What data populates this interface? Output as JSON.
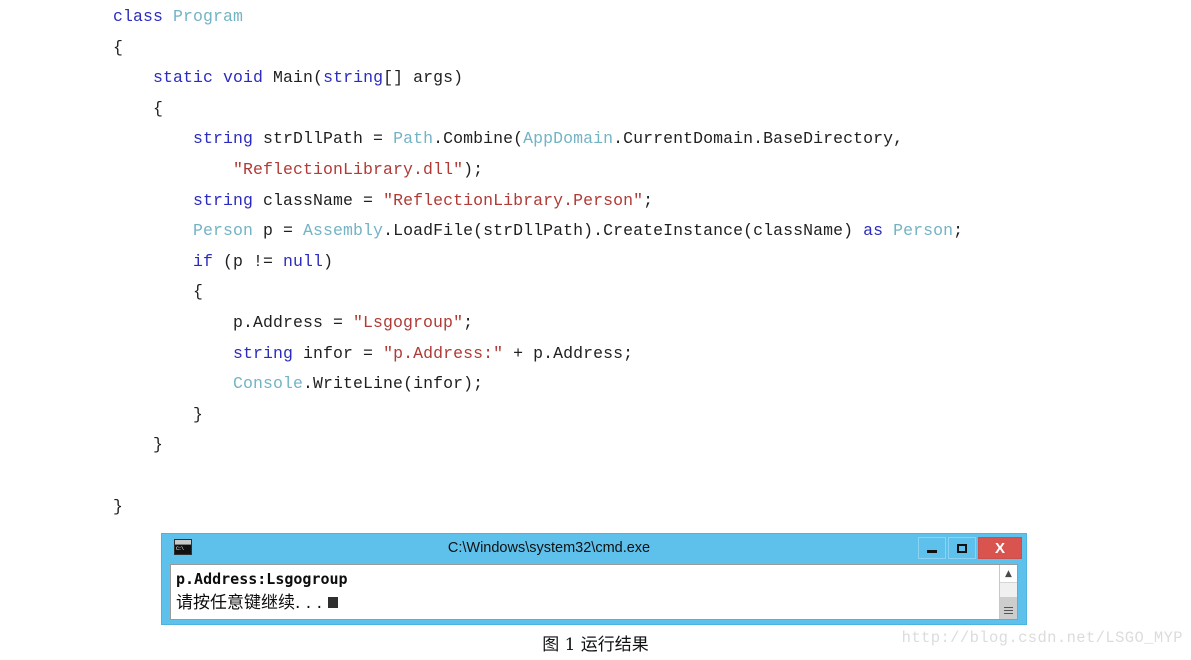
{
  "code": {
    "language": "csharp",
    "lines": [
      [
        {
          "t": "class ",
          "c": "kw"
        },
        {
          "t": "Program",
          "c": "typ"
        }
      ],
      [
        {
          "t": "{",
          "c": "pln"
        }
      ],
      [
        {
          "t": "    ",
          "c": "pln"
        },
        {
          "t": "static void ",
          "c": "kw"
        },
        {
          "t": "Main(",
          "c": "pln"
        },
        {
          "t": "string",
          "c": "kw"
        },
        {
          "t": "[] args)",
          "c": "pln"
        }
      ],
      [
        {
          "t": "    {",
          "c": "pln"
        }
      ],
      [
        {
          "t": "        ",
          "c": "pln"
        },
        {
          "t": "string",
          "c": "kw"
        },
        {
          "t": " strDllPath = ",
          "c": "pln"
        },
        {
          "t": "Path",
          "c": "typ"
        },
        {
          "t": ".Combine(",
          "c": "pln"
        },
        {
          "t": "AppDomain",
          "c": "typ"
        },
        {
          "t": ".CurrentDomain.BaseDirectory,",
          "c": "pln"
        }
      ],
      [
        {
          "t": "            ",
          "c": "pln"
        },
        {
          "t": "\"ReflectionLibrary.dll\"",
          "c": "str"
        },
        {
          "t": ");",
          "c": "pln"
        }
      ],
      [
        {
          "t": "        ",
          "c": "pln"
        },
        {
          "t": "string",
          "c": "kw"
        },
        {
          "t": " className = ",
          "c": "pln"
        },
        {
          "t": "\"ReflectionLibrary.Person\"",
          "c": "str"
        },
        {
          "t": ";",
          "c": "pln"
        }
      ],
      [
        {
          "t": "        ",
          "c": "pln"
        },
        {
          "t": "Person",
          "c": "typ"
        },
        {
          "t": " p = ",
          "c": "pln"
        },
        {
          "t": "Assembly",
          "c": "typ"
        },
        {
          "t": ".LoadFile(strDllPath).CreateInstance(className) ",
          "c": "pln"
        },
        {
          "t": "as ",
          "c": "kw"
        },
        {
          "t": "Person",
          "c": "typ"
        },
        {
          "t": ";",
          "c": "pln"
        }
      ],
      [
        {
          "t": "        ",
          "c": "pln"
        },
        {
          "t": "if",
          "c": "kw"
        },
        {
          "t": " (p != ",
          "c": "pln"
        },
        {
          "t": "null",
          "c": "kw"
        },
        {
          "t": ")",
          "c": "pln"
        }
      ],
      [
        {
          "t": "        {",
          "c": "pln"
        }
      ],
      [
        {
          "t": "            p.Address = ",
          "c": "pln"
        },
        {
          "t": "\"Lsgogroup\"",
          "c": "str"
        },
        {
          "t": ";",
          "c": "pln"
        }
      ],
      [
        {
          "t": "            ",
          "c": "pln"
        },
        {
          "t": "string",
          "c": "kw"
        },
        {
          "t": " infor = ",
          "c": "pln"
        },
        {
          "t": "\"p.Address:\"",
          "c": "str"
        },
        {
          "t": " + p.Address;",
          "c": "pln"
        }
      ],
      [
        {
          "t": "            ",
          "c": "pln"
        },
        {
          "t": "Console",
          "c": "typ"
        },
        {
          "t": ".WriteLine(infor);",
          "c": "pln"
        }
      ],
      [
        {
          "t": "        }",
          "c": "pln"
        }
      ],
      [
        {
          "t": "    }",
          "c": "pln"
        }
      ],
      [
        {
          "t": "",
          "c": "pln"
        }
      ],
      [
        {
          "t": "}",
          "c": "pln"
        }
      ]
    ]
  },
  "console_window": {
    "title": "C:\\Windows\\system32\\cmd.exe",
    "icon_label": "C:\\",
    "titlebar_color": "#5ec1ec",
    "close_button_color": "#d9534f",
    "buttons": {
      "minimize_label": "",
      "maximize_label": "",
      "close_label": "X"
    },
    "output_line_1": "p.Address:Lsgogroup",
    "output_line_2": "请按任意键继续. . .",
    "scroll_up_arrow": "▲"
  },
  "caption": "图 1  运行结果",
  "watermark": "http://blog.csdn.net/LSGO_MYP"
}
